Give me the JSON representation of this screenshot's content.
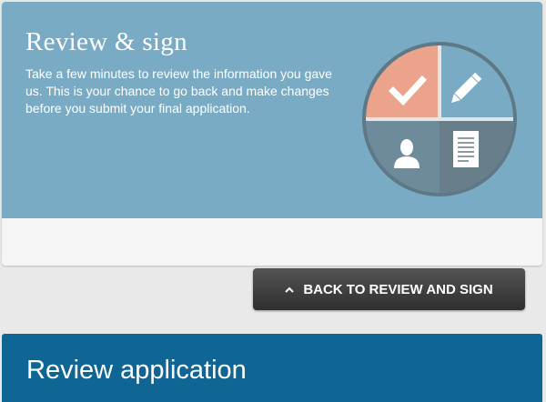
{
  "hero": {
    "title": "Review & sign",
    "description": "Take a few minutes to review the information you gave us. This is your chance to go back and make changes before you submit your final application."
  },
  "back_button": {
    "icon": "chevron-up-icon",
    "label": "BACK TO REVIEW AND SIGN"
  },
  "section": {
    "title": "Review application"
  },
  "colors": {
    "hero_bg": "#7aabc4",
    "quadrant_done": "#eba38b",
    "quadrant_light": "#7aabc4",
    "quadrant_dark": "#6e8b9b",
    "button_bg": "#3b3b3b",
    "section_bg": "#0f6594"
  },
  "illustration": {
    "icons": [
      "checkmark-icon",
      "pencil-icon",
      "person-icon",
      "document-icon"
    ]
  }
}
